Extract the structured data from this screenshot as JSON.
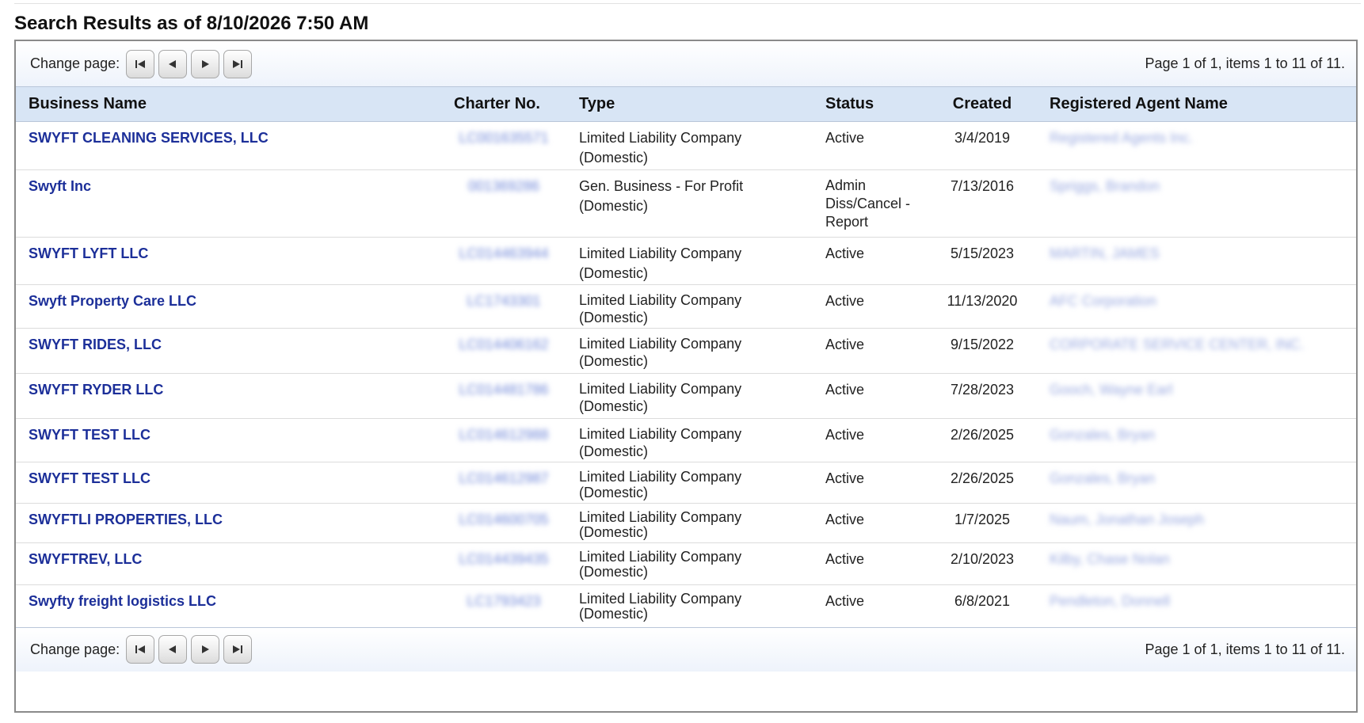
{
  "title": "Search Results as of 8/10/2026 7:50 AM",
  "pager": {
    "label": "Change page:",
    "buttons": [
      "first-page",
      "previous-page",
      "next-page",
      "last-page"
    ],
    "summary": "Page 1 of 1, items 1 to 11 of 11."
  },
  "columns": [
    "Business Name",
    "Charter No.",
    "Type",
    "Status",
    "Created",
    "Registered Agent Name"
  ],
  "rows": [
    {
      "name": "SWYFT CLEANING SERVICES, LLC",
      "charter": "LC001635571",
      "type": "Limited Liability Company",
      "type_sub": "(Domestic)",
      "status": "Active",
      "created": "3/4/2019",
      "agent": "Registered Agents Inc."
    },
    {
      "name": "Swyft Inc",
      "charter": "001369286",
      "type": "Gen. Business - For Profit",
      "type_sub": "(Domestic)",
      "status": "Admin Diss/Cancel - Report",
      "created": "7/13/2016",
      "agent": "Spriggs, Brandon"
    },
    {
      "name": "SWYFT LYFT LLC",
      "charter": "LC014463944",
      "type": "Limited Liability Company",
      "type_sub": "(Domestic)",
      "status": "Active",
      "created": "5/15/2023",
      "agent": "MARTIN, JAMES"
    },
    {
      "name": "Swyft Property Care LLC",
      "charter": "LC1743301",
      "type": "Limited Liability Company",
      "type_sub": "(Domestic)",
      "status": "Active",
      "created": "11/13/2020",
      "agent": "AFC Corporation"
    },
    {
      "name": "SWYFT RIDES, LLC",
      "charter": "LC014406162",
      "type": "Limited Liability Company",
      "type_sub": "(Domestic)",
      "status": "Active",
      "created": "9/15/2022",
      "agent": "CORPORATE SERVICE CENTER, INC."
    },
    {
      "name": "SWYFT RYDER LLC",
      "charter": "LC014481786",
      "type": "Limited Liability Company",
      "type_sub": "(Domestic)",
      "status": "Active",
      "created": "7/28/2023",
      "agent": "Gooch, Wayne Earl"
    },
    {
      "name": "SWYFT TEST LLC",
      "charter": "LC014612988",
      "type": "Limited Liability Company",
      "type_sub": "(Domestic)",
      "status": "Active",
      "created": "2/26/2025",
      "agent": "Gonzales, Bryan"
    },
    {
      "name": "SWYFT TEST LLC",
      "charter": "LC014612987",
      "type": "Limited Liability Company",
      "type_sub": "(Domestic)",
      "status": "Active",
      "created": "2/26/2025",
      "agent": "Gonzales, Bryan"
    },
    {
      "name": "SWYFTLI PROPERTIES, LLC",
      "charter": "LC014600705",
      "type": "Limited Liability Company",
      "type_sub": "(Domestic)",
      "status": "Active",
      "created": "1/7/2025",
      "agent": "Naum, Jonathan Joseph"
    },
    {
      "name": "SWYFTREV, LLC",
      "charter": "LC014439435",
      "type": "Limited Liability Company",
      "type_sub": "(Domestic)",
      "status": "Active",
      "created": "2/10/2023",
      "agent": "Kilby, Chase Nolan"
    },
    {
      "name": "Swyfty freight logistics LLC",
      "charter": "LC1793423",
      "type": "Limited Liability Company",
      "type_sub": "(Domestic)",
      "status": "Active",
      "created": "6/8/2021",
      "agent": "Pendleton, Donnell"
    }
  ],
  "colors": {
    "link": "#1c2f99",
    "header_bg": "#d8e5f5",
    "border": "#8a8a8a"
  }
}
